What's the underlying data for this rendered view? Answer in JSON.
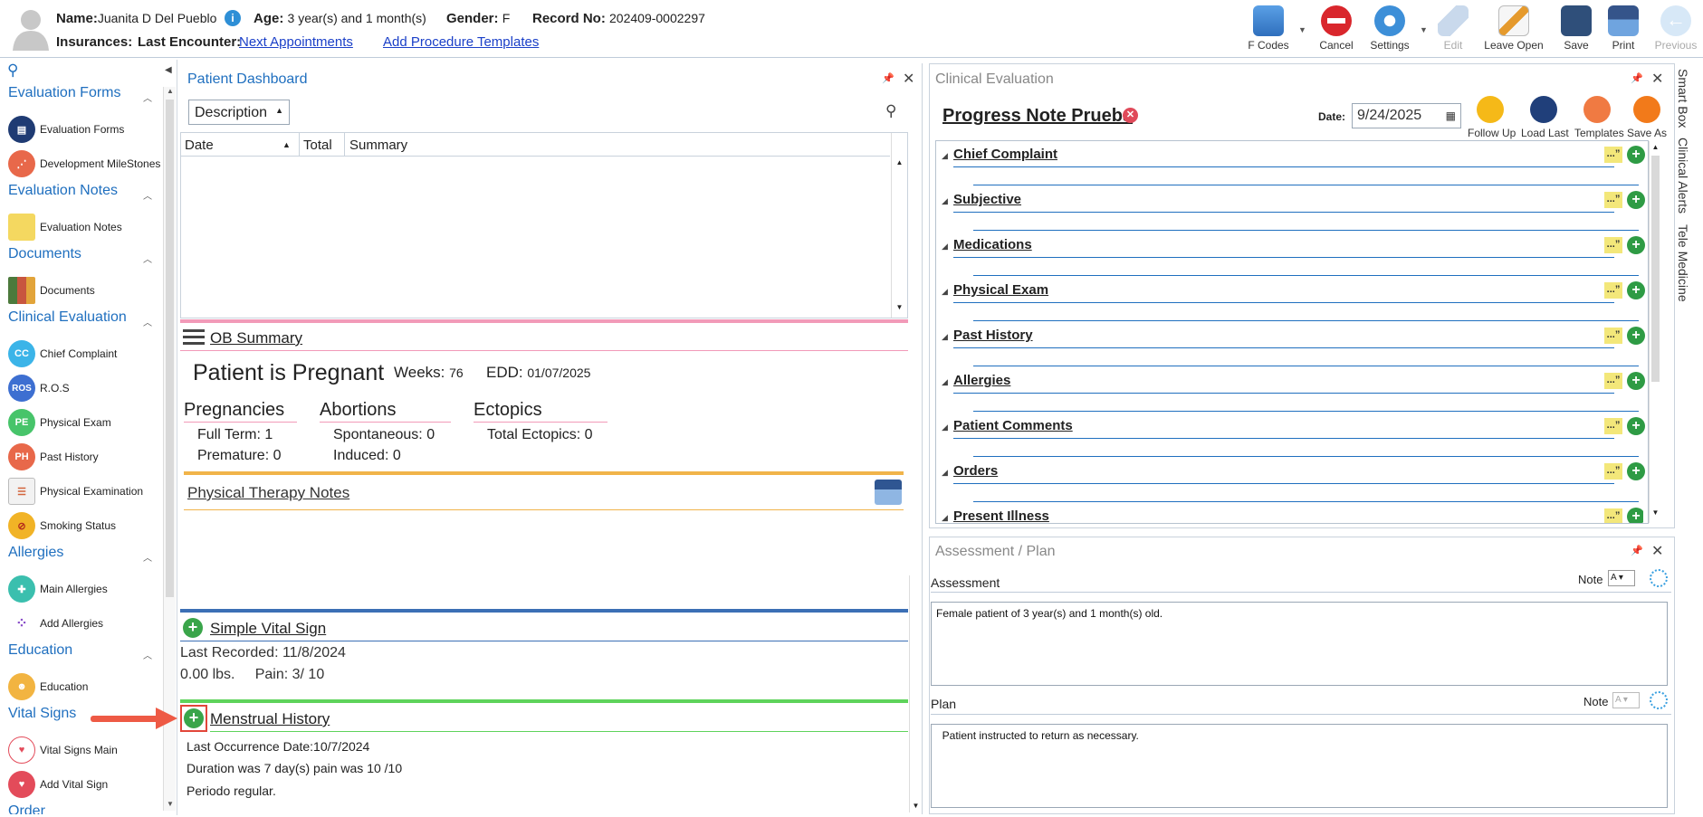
{
  "header": {
    "name_label": "Name:",
    "name_value": "Juanita D Del Pueblo",
    "age_label": "Age:",
    "age_value": "3 year(s) and 1 month(s)",
    "gender_label": "Gender:",
    "gender_value": "F",
    "record_label": "Record No:",
    "record_value": "202409-0002297",
    "insurances_label": "Insurances:",
    "last_encounter_label": "Last Encounter:",
    "next_appointments": "Next Appointments",
    "add_procedure_templates": "Add Procedure Templates"
  },
  "toolbar": {
    "fcodes": "F Codes",
    "cancel": "Cancel",
    "settings": "Settings",
    "edit": "Edit",
    "leave_open": "Leave Open",
    "save": "Save",
    "print": "Print",
    "previous": "Previous"
  },
  "sidebar": {
    "groups": {
      "evaluation_forms": "Evaluation Forms",
      "evaluation_notes": "Evaluation Notes",
      "documents": "Documents",
      "clinical_evaluation": "Clinical Evaluation",
      "allergies": "Allergies",
      "education": "Education",
      "vital_signs": "Vital Signs",
      "order": "Order"
    },
    "items": {
      "evaluation_forms": "Evaluation Forms",
      "development_milestones": "Development MileStones",
      "evaluation_notes": "Evaluation Notes",
      "documents": "Documents",
      "chief_complaint": "Chief Complaint",
      "ros": "R.O.S",
      "physical_exam": "Physical Exam",
      "past_history": "Past History",
      "physical_examination": "Physical Examination",
      "smoking_status": "Smoking Status",
      "main_allergies": "Main Allergies",
      "add_allergies": "Add Allergies",
      "education": "Education",
      "vital_signs_main": "Vital Signs Main",
      "add_vital_sign": "Add Vital Sign"
    },
    "icon_text": {
      "cc": "CC",
      "ros": "ROS",
      "pe": "PE",
      "ph": "PH"
    }
  },
  "dashboard": {
    "title": "Patient Dashboard",
    "description_dropdown": "Description",
    "columns": [
      "Date",
      "Total",
      "Summary"
    ],
    "ob_summary": {
      "title": "OB Summary",
      "pregnant_text": "Patient is Pregnant",
      "weeks_label": "Weeks:",
      "weeks_value": "76",
      "edd_label": "EDD:",
      "edd_value": "01/07/2025",
      "pregnancies_label": "Pregnancies",
      "abortions_label": "Abortions",
      "ectopics_label": "Ectopics",
      "full_term": "Full Term: 1",
      "premature": "Premature: 0",
      "spontaneous": "Spontaneous: 0",
      "induced": "Induced: 0",
      "total_ectopics": "Total Ectopics: 0"
    },
    "physical_therapy_notes": "Physical Therapy Notes",
    "simple_vital_sign": {
      "title": "Simple Vital Sign",
      "last_recorded": "Last Recorded: 11/8/2024",
      "values": "0.00 lbs.     Pain: 3/ 10"
    },
    "menstrual_history": {
      "title": "Menstrual History",
      "last_occurrence": "Last Occurrence Date:10/7/2024",
      "duration": "Duration was 7 day(s) pain was 10 /10",
      "periodo": "Periodo regular."
    }
  },
  "clinical_evaluation": {
    "title": "Clinical Evaluation",
    "note_title": "Progress Note Prueba",
    "date_label": "Date:",
    "date_value": "9/24/2025",
    "buttons": {
      "follow_up": "Follow Up",
      "load_last": "Load Last",
      "templates": "Templates",
      "save_as": "Save As"
    },
    "quote_glyph": "...”",
    "sections": [
      "Chief Complaint",
      "Subjective",
      "Medications",
      "Physical Exam",
      "Past History",
      "Allergies",
      "Patient Comments",
      "Orders",
      "Present Illness"
    ]
  },
  "assessment_plan": {
    "title": "Assessment / Plan",
    "assessment_label": "Assessment",
    "note_label": "Note",
    "assessment_text": "Female patient of 3 year(s) and 1 month(s) old.",
    "plan_label": "Plan",
    "plan_text": "  Patient instructed to return as necessary."
  },
  "right_tabs": [
    "Smart Box",
    "Clinical Alerts",
    "Tele Medicine"
  ],
  "colors": {
    "accent_blue": "#1f6fbf",
    "green": "#3aa54a",
    "red": "#d9262c",
    "pink_bar": "#f29ab8",
    "orange_bar": "#f1b44a",
    "blue_bar": "#3c6fb5",
    "green_bar": "#5ed35b",
    "arrow": "#ee5a45"
  }
}
